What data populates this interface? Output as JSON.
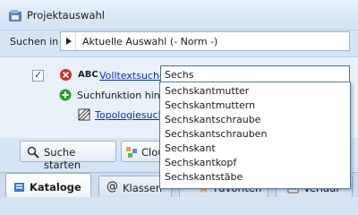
{
  "window": {
    "title": "Projektauswahl"
  },
  "scope": {
    "label": "Suchen in",
    "value": "Aktuelle Auswahl (- Norm -)"
  },
  "criteria": {
    "badge": "ABC",
    "fulltext_link": "Volltextsuche",
    "query_value": "Sechs",
    "add_function_label": "Suchfunktion hinzufü",
    "topology_link": "Topologiesuche"
  },
  "dropdown": {
    "items": [
      "Sechskantmutter",
      "Sechskantmuttern",
      "Sechskantschraube",
      "Sechskantschrauben",
      "Sechskant",
      "Sechskantkopf",
      "Sechskantstäbe"
    ]
  },
  "buttons": {
    "start_search": "Suche starten",
    "cloud": "Clou"
  },
  "tabs": [
    {
      "label": "Kataloge",
      "icon": "catalog-icon"
    },
    {
      "label": "Klassen",
      "icon": "at-icon"
    },
    {
      "label": "Favoriten",
      "icon": "star-icon"
    },
    {
      "label": "Verlauf",
      "icon": "history-icon"
    }
  ],
  "colors": {
    "link": "#0b2fb8",
    "background": "#d6e5f5",
    "accent_green": "#2e9e2e",
    "accent_red": "#d0302a"
  }
}
